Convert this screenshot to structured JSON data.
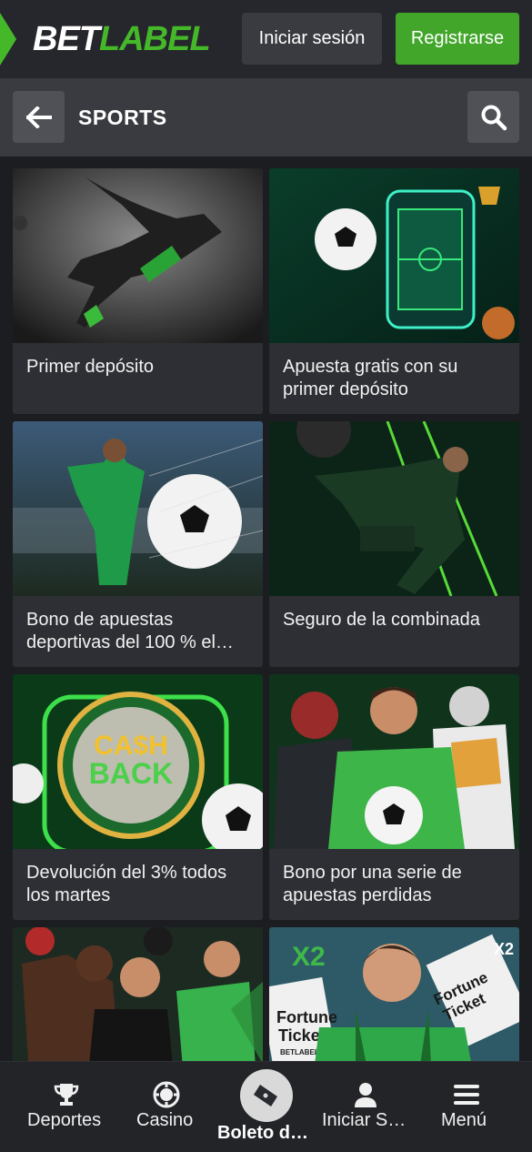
{
  "header": {
    "logo_bet": "BET",
    "logo_label": "LABEL",
    "login_label": "Iniciar sesión",
    "register_label": "Registrarse",
    "accent_color": "#45b82a"
  },
  "subheader": {
    "title": "SPORTS",
    "back_icon": "arrow-left-icon",
    "search_icon": "search-icon"
  },
  "promotions": [
    {
      "caption": "Primer depósito",
      "image": "soccer-player-kick"
    },
    {
      "caption": "Apuesta gratis con su primer depósito",
      "image": "ball-phone-trophy"
    },
    {
      "caption": "Bono de apuestas deportivas del 100 % el…",
      "image": "player-celebrate-net"
    },
    {
      "caption": "Seguro de la combinada",
      "image": "player-bicycle-kick"
    },
    {
      "caption": "Devolución del 3% todos los martes",
      "image": "cashback-ball"
    },
    {
      "caption": "Bono por una serie de apuestas perdidas",
      "image": "athletes-group"
    },
    {
      "caption": "",
      "image": "boxer-group"
    },
    {
      "caption": "",
      "image": "fortune-ticket-fan"
    }
  ],
  "image_text": {
    "cash": "CA$H",
    "back": "BACK",
    "fortune": "Fortune",
    "ticket": "Ticket",
    "x2": "X2",
    "betlabel": "BETLABEL"
  },
  "bottom_nav": {
    "items": [
      {
        "label": "Deportes",
        "icon": "trophy-icon"
      },
      {
        "label": "Casino",
        "icon": "chip-icon"
      },
      {
        "label": "Boleto d…",
        "icon": "ticket-icon"
      },
      {
        "label": "Iniciar S…",
        "icon": "user-icon"
      },
      {
        "label": "Menú",
        "icon": "menu-icon"
      }
    ]
  }
}
